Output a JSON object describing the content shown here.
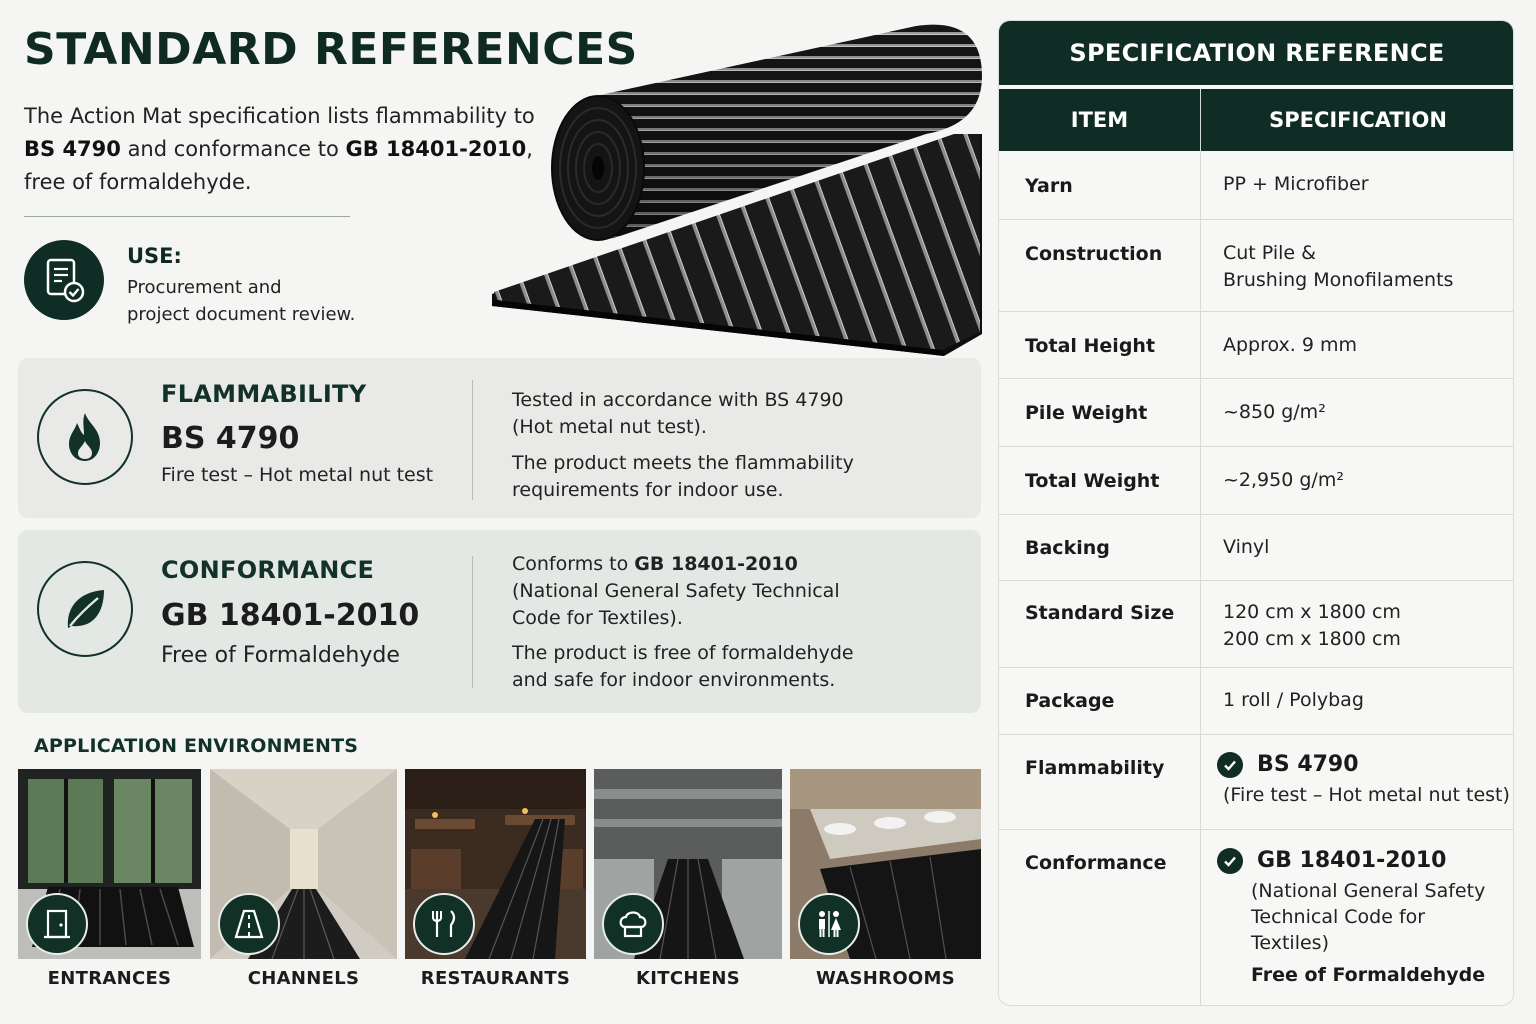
{
  "header": {
    "title": "STANDARD REFERENCES",
    "intro": {
      "part1": "The Action Mat specification lists flammability to ",
      "std1": "BS 4790",
      "part2": " and conformance to ",
      "std2": "GB 18401-2010",
      "part3": ",",
      "part4": "free of formaldehyde."
    }
  },
  "use": {
    "icon": "document-check-icon",
    "heading": "USE:",
    "text_line1": "Procurement and",
    "text_line2": "project document review."
  },
  "cards": {
    "flammability": {
      "icon": "flame-icon",
      "kicker": "FLAMMABILITY",
      "standard": "BS 4790",
      "subtitle": "Fire test – Hot metal nut test",
      "desc1_line1": "Tested in accordance with BS 4790",
      "desc1_line2": "(Hot metal nut test).",
      "desc2_line1": "The product meets the flammability",
      "desc2_line2": "requirements for indoor use."
    },
    "conformance": {
      "icon": "leaf-icon",
      "kicker": "CONFORMANCE",
      "standard": "GB 18401-2010",
      "subtitle": "Free of Formaldehyde",
      "desc1_prefix": "Conforms to ",
      "desc1_standard": "GB 18401-2010",
      "desc1_line2": "(National General Safety Technical",
      "desc1_line3": "Code for Textiles).",
      "desc2_line1": "The product is free of formaldehyde",
      "desc2_line2": "and safe for indoor environments."
    }
  },
  "environments": {
    "heading": "APPLICATION ENVIRONMENTS",
    "items": [
      {
        "label": "ENTRANCES",
        "icon": "door-icon"
      },
      {
        "label": "CHANNELS",
        "icon": "corridor-icon"
      },
      {
        "label": "RESTAURANTS",
        "icon": "fork-knife-icon"
      },
      {
        "label": "KITCHENS",
        "icon": "chef-hat-icon"
      },
      {
        "label": "WASHROOMS",
        "icon": "restroom-icon"
      }
    ]
  },
  "spec_table": {
    "title": "SPECIFICATION REFERENCE",
    "col_item": "ITEM",
    "col_spec": "SPECIFICATION",
    "rows": [
      {
        "item": "Yarn",
        "spec": [
          "PP + Microfiber"
        ]
      },
      {
        "item": "Construction",
        "spec": [
          "Cut Pile &",
          "Brushing Monofilaments"
        ]
      },
      {
        "item": "Total Height",
        "spec": [
          "Approx. 9 mm"
        ]
      },
      {
        "item": "Pile Weight",
        "spec": [
          "~850 g/m²"
        ]
      },
      {
        "item": "Total Weight",
        "spec": [
          "~2,950 g/m²"
        ]
      },
      {
        "item": "Backing",
        "spec": [
          "Vinyl"
        ]
      },
      {
        "item": "Standard Size",
        "spec": [
          "120 cm x 1800 cm",
          "200 cm x 1800 cm"
        ]
      },
      {
        "item": "Package",
        "spec": [
          "1 roll / Polybag"
        ]
      }
    ],
    "flammability": {
      "item": "Flammability",
      "standard": "BS 4790",
      "note": "(Fire test – Hot metal nut test)"
    },
    "conformance": {
      "item": "Conformance",
      "standard": "GB 18401-2010",
      "note_line1": "(National General Safety",
      "note_line2": "Technical Code for",
      "note_line3": "Textiles)",
      "extra": "Free of Formaldehyde"
    }
  },
  "colors": {
    "brand_dark_green": "#0f2d24",
    "card_grey": "#e9eae8",
    "card_green_tint": "#e3e8e4",
    "page_bg": "#f5f5f4"
  }
}
